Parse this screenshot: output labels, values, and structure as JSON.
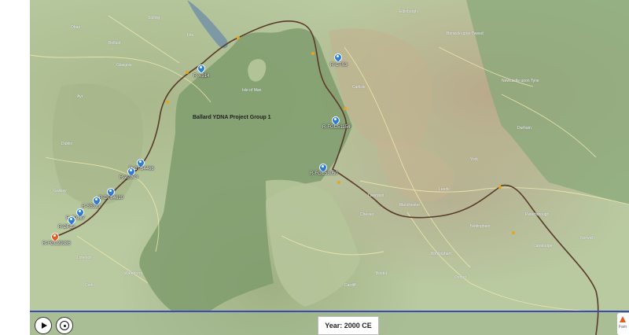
{
  "map": {
    "group_label": "Ballard YDNA Project Group 1",
    "year_display": "Year: 2000 CE",
    "route_color": "#5a3a2a",
    "timeline_color": "#3a4bb5",
    "markers": [
      {
        "label": "R-A914",
        "color": "blue"
      },
      {
        "label": "R-CTS3",
        "color": "blue"
      },
      {
        "label": "R-FGC51154",
        "color": "blue"
      },
      {
        "label": "R-FGC53050",
        "color": "blue"
      },
      {
        "label": "R-CTS4466",
        "color": "blue"
      },
      {
        "label": "R-Z2073",
        "color": "blue"
      },
      {
        "label": "R-DF84610",
        "color": "blue"
      },
      {
        "label": "R-S5321",
        "color": "blue"
      },
      {
        "label": "R-ZP127",
        "color": "blue"
      },
      {
        "label": "R-DF13",
        "color": "blue"
      },
      {
        "label": "R-FGC29386",
        "color": "orange"
      }
    ],
    "places": [
      "Oban",
      "Stirling",
      "Fife",
      "Glasgow",
      "Edinburgh",
      "Berwick-upon-Tweed",
      "Ayr",
      "Carlisle",
      "Newcastle upon Tyne",
      "Durham",
      "York",
      "Leeds",
      "Dublin",
      "Belfast",
      "Isle of Man",
      "Liverpool",
      "Manchester",
      "Chester",
      "Birmingham",
      "Nottingham",
      "Cork",
      "Limerick",
      "Galway",
      "Waterford",
      "Cardiff",
      "Bristol",
      "Oxford",
      "Cambridge",
      "Peterborough",
      "Norwich"
    ]
  },
  "controls": {
    "play": "play-icon",
    "speed": "speed-icon",
    "logo": "Fam"
  }
}
